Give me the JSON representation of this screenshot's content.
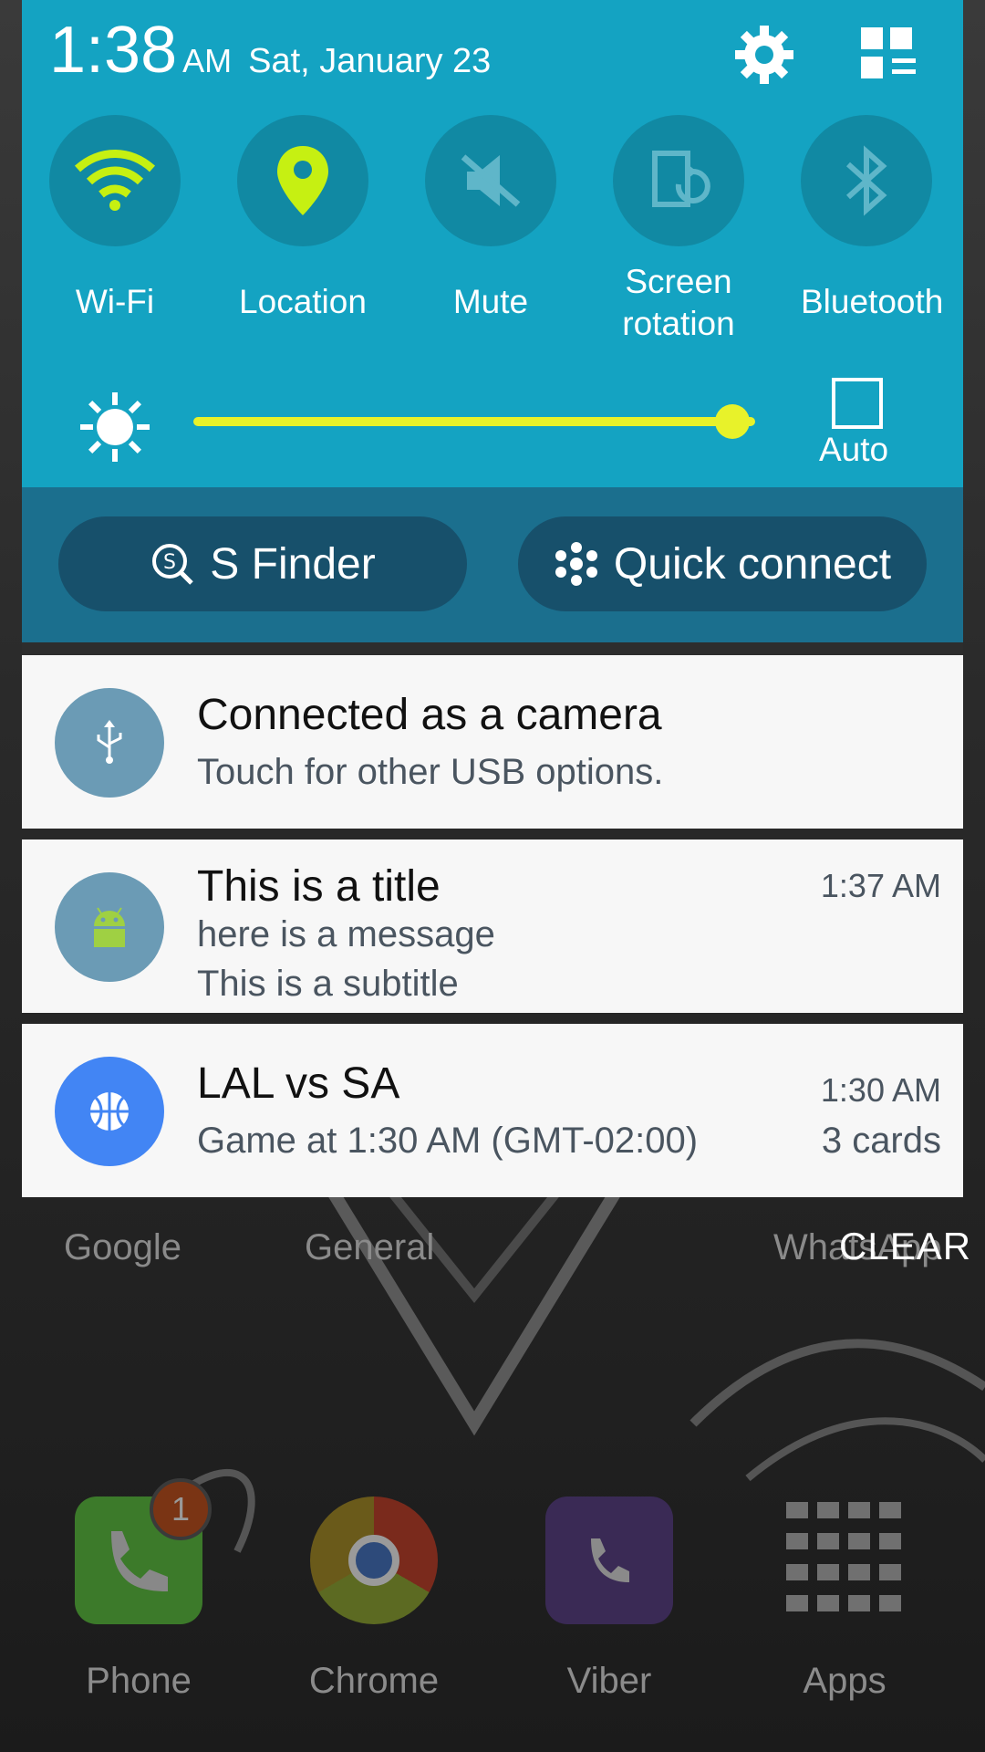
{
  "status": {
    "time": "1:38",
    "ampm": "AM",
    "date": "Sat, January 23"
  },
  "quick_toggles": [
    {
      "label": "Wi-Fi",
      "icon": "wifi-icon",
      "active": true
    },
    {
      "label": "Location",
      "icon": "location-pin-icon",
      "active": true
    },
    {
      "label": "Mute",
      "icon": "mute-icon",
      "active": false
    },
    {
      "label_line1": "Screen",
      "label_line2": "rotation",
      "icon": "screen-rotation-icon",
      "active": false
    },
    {
      "label": "Bluetooth",
      "icon": "bluetooth-icon",
      "active": false
    }
  ],
  "brightness": {
    "level": 0.96,
    "auto_label": "Auto",
    "auto_checked": false
  },
  "buttons": {
    "s_finder": "S Finder",
    "quick_connect": "Quick connect"
  },
  "notifications": [
    {
      "title": "Connected as a camera",
      "line1": "Touch for other USB options.",
      "icon": "usb-icon",
      "color": "#6b9bb5"
    },
    {
      "title": "This is a title",
      "line1": "here is a message",
      "line2": "This is a subtitle",
      "time": "1:37 AM",
      "icon": "android-icon",
      "color": "#6b9bb5"
    },
    {
      "title": "LAL vs SA",
      "line1": "Game at 1:30 AM (GMT-02:00)",
      "time": "1:30 AM",
      "extra": "3 cards",
      "icon": "basketball-icon",
      "color": "#4285f4"
    }
  ],
  "clear_label": "CLEAR",
  "home": {
    "folder_labels": [
      "Google",
      "General",
      "WhatsApp"
    ],
    "dock": [
      {
        "label": "Phone",
        "badge": "1"
      },
      {
        "label": "Chrome"
      },
      {
        "label": "Viber"
      },
      {
        "label": "Apps"
      }
    ]
  },
  "colors": {
    "qs_bg": "#14a3c2",
    "toggle_active": "#c6f012",
    "slider": "#e8f22a",
    "finder_bg": "#1b6f8e"
  }
}
